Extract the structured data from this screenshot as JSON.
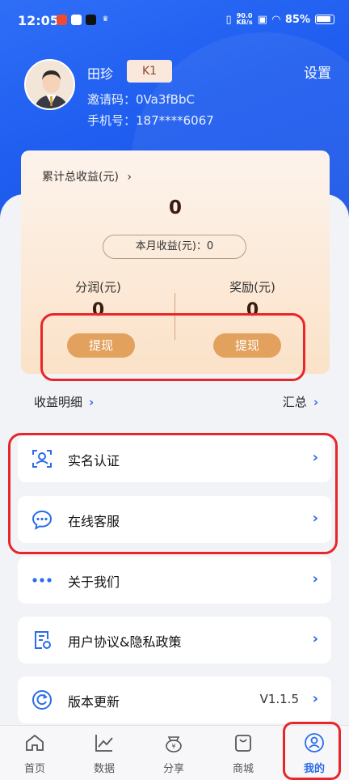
{
  "status_bar": {
    "time": "12:05",
    "network_speed": "90.0\nKB/s",
    "battery": "85%"
  },
  "profile": {
    "name": "田珍",
    "level": "K1",
    "invite_code": "邀请码：0Va3fBbC",
    "phone": "手机号：187****6067",
    "settings_label": "设置"
  },
  "earnings": {
    "total_label": "累计总收益(元)",
    "total_value": "0",
    "month_label": "本月收益(元)：0",
    "share_label": "分润(元)",
    "share_value": "0",
    "reward_label": "奖励(元)",
    "reward_value": "0",
    "withdraw_label": "提现"
  },
  "detail_row": {
    "left": "收益明细",
    "right": "汇总"
  },
  "menu": [
    {
      "label": "实名认证",
      "icon": "id-verify-icon"
    },
    {
      "label": "在线客服",
      "icon": "chat-icon"
    },
    {
      "label": "关于我们",
      "icon": "more-dots-icon"
    },
    {
      "label": "用户协议&隐私政策",
      "icon": "document-icon"
    },
    {
      "label": "版本更新",
      "icon": "refresh-icon",
      "value": "V1.1.5"
    }
  ],
  "tabs": [
    {
      "label": "首页",
      "icon": "home-icon"
    },
    {
      "label": "数据",
      "icon": "chart-icon"
    },
    {
      "label": "分享",
      "icon": "share-money-icon"
    },
    {
      "label": "商城",
      "icon": "shopping-bag-icon"
    },
    {
      "label": "我的",
      "icon": "profile-icon",
      "active": true
    }
  ],
  "colors": {
    "brand_blue": "#2b6bea",
    "highlight_red": "#e8262a",
    "withdraw_orange": "#e2a15c"
  }
}
